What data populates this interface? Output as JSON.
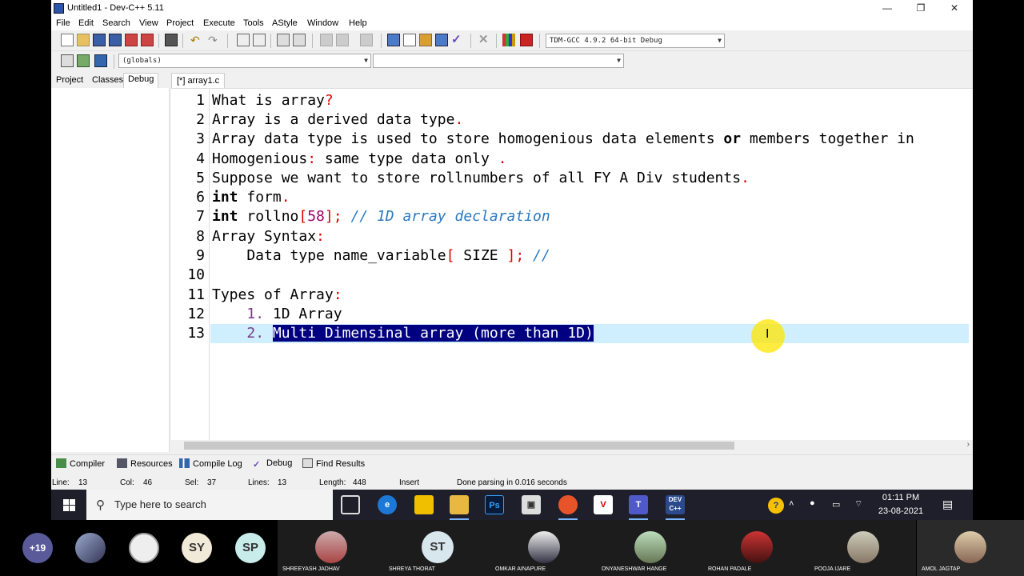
{
  "window": {
    "title": "Untitled1 - Dev-C++ 5.11",
    "minimize": "—",
    "restore": "❐",
    "close": "✕"
  },
  "menu": [
    "File",
    "Edit",
    "Search",
    "View",
    "Project",
    "Execute",
    "Tools",
    "AStyle",
    "Window",
    "Help"
  ],
  "toolbar": {
    "compiler_select": "TDM-GCC 4.9.2 64-bit Debug",
    "scope_select": "(globals)",
    "member_select": ""
  },
  "left_tabs": [
    "Project",
    "Classes",
    "Debug"
  ],
  "editor_tab": "[*] array1.c",
  "code_lines": [
    "What is array?",
    "Array is a derived data type.",
    "Array data type is used to store homogenious data elements or members together in",
    "Homogenious: same type data only .",
    "Suppose we want to store rollnumbers of all FY A Div students.",
    "int form.",
    "int rollno[58]; // 1D array declaration",
    "Array Syntax:",
    "    Data type name_variable[ SIZE ]; //",
    "",
    "Types of Array:",
    "    1. 1D Array",
    "    2. Multi Dimensinal array (more than 1D)"
  ],
  "bottom_tabs": [
    "Compiler",
    "Resources",
    "Compile Log",
    "Debug",
    "Find Results"
  ],
  "status": {
    "line": "Line:",
    "line_val": "13",
    "col": "Col:",
    "col_val": "46",
    "sel": "Sel:",
    "sel_val": "37",
    "lines": "Lines:",
    "lines_val": "13",
    "length": "Length:",
    "length_val": "448",
    "mode": "Insert",
    "message": "Done parsing in 0.016 seconds"
  },
  "taskbar": {
    "search_placeholder": "Type here to search",
    "time": "01:11 PM",
    "date": "23-08-2021"
  },
  "participants": {
    "more": "+19",
    "initials": [
      "SY",
      "SP"
    ],
    "tiles": [
      {
        "initials": "",
        "name": "SHREEYASH JADHAV"
      },
      {
        "initials": "ST",
        "name": "SHREYA THORAT"
      },
      {
        "initials": "",
        "name": "OMKAR AINAPURE"
      },
      {
        "initials": "",
        "name": "DNYANESHWAR HANGE"
      },
      {
        "initials": "",
        "name": "ROHAN PADALE"
      },
      {
        "initials": "",
        "name": "POOJA IJARE"
      },
      {
        "initials": "",
        "name": "AMOL JAGTAP"
      }
    ]
  }
}
